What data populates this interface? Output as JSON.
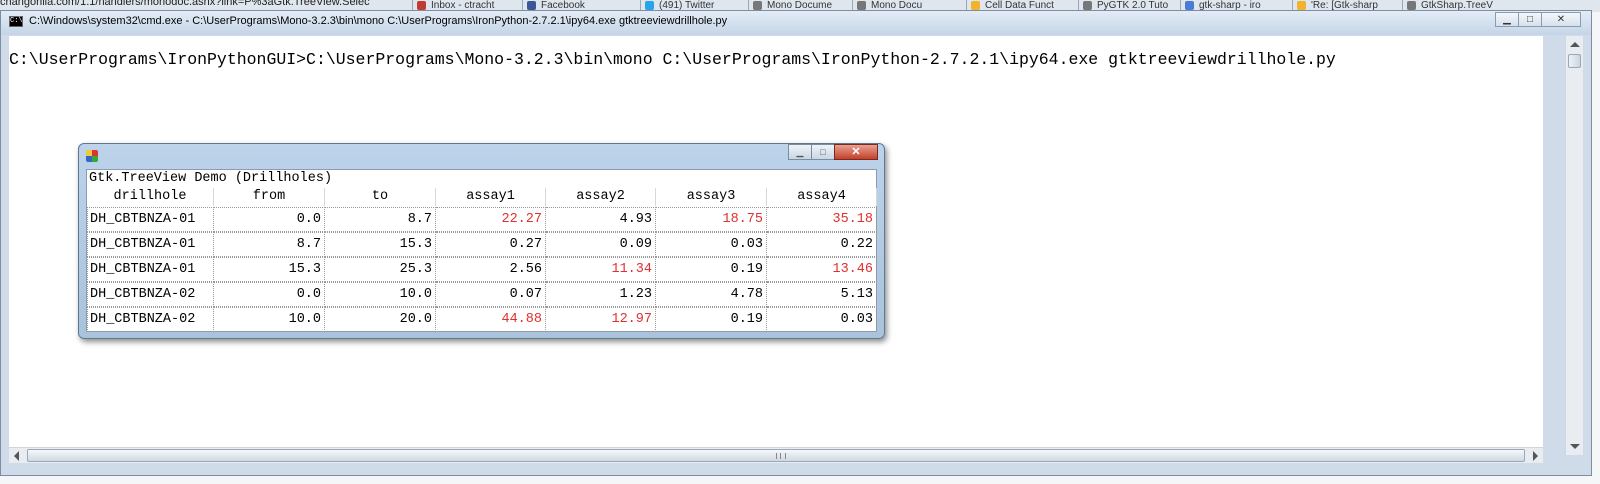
{
  "background": {
    "url": "changorilla.com/1.1/handlers/monodoc.ashx?link=P%3aGtk.TreeView.Selec",
    "tabs": [
      {
        "label": "Inbox - ctracht",
        "icon": "mail-icon",
        "color": "#c23b2e"
      },
      {
        "label": "Facebook",
        "icon": "facebook-icon",
        "color": "#3b5998"
      },
      {
        "label": "(491) Twitter",
        "icon": "twitter-icon",
        "color": "#2aa3ef"
      },
      {
        "label": "Mono Docume",
        "icon": "page-icon",
        "color": "#777777"
      },
      {
        "label": "Mono Docu",
        "icon": "page-icon",
        "color": "#777777"
      },
      {
        "label": "Cell Data Funct",
        "icon": "ie-icon",
        "color": "#f1b32a"
      },
      {
        "label": "PyGTK 2.0 Tuto",
        "icon": "page-icon",
        "color": "#777777"
      },
      {
        "label": "gtk-sharp - iro",
        "icon": "google-icon",
        "color": "#4a7cd6"
      },
      {
        "label": "'Re: [Gtk-sharp",
        "icon": "ie-icon",
        "color": "#f1b32a"
      },
      {
        "label": "GtkSharp.TreeV",
        "icon": "page-icon",
        "color": "#777777"
      }
    ]
  },
  "console": {
    "title": "C:\\Windows\\system32\\cmd.exe - C:\\UserPrograms\\Mono-3.2.3\\bin\\mono  C:\\UserPrograms\\IronPython-2.7.2.1\\ipy64.exe gtktreeviewdrillhole.py",
    "icon_text": "C:\\",
    "command_line": "C:\\UserPrograms\\IronPythonGUI>C:\\UserPrograms\\Mono-3.2.3\\bin\\mono C:\\UserPrograms\\IronPython-2.7.2.1\\ipy64.exe gtktreeviewdrillhole.py",
    "buttons": {
      "minimize": "▁",
      "maximize": "□",
      "close": "✕"
    }
  },
  "dialog": {
    "caption": "Gtk.TreeView Demo (Drillholes)",
    "buttons": {
      "minimize": "▁",
      "maximize": "□",
      "close": "✕"
    },
    "columns": [
      "drillhole",
      "from",
      "to",
      "assay1",
      "assay2",
      "assay3",
      "assay4"
    ],
    "rows": [
      {
        "cells": [
          "DH_CBTBNZA-01",
          "0.0",
          "8.7",
          "22.27",
          "4.93",
          "18.75",
          "35.18"
        ],
        "red": [
          false,
          false,
          false,
          true,
          false,
          true,
          true
        ]
      },
      {
        "cells": [
          "DH_CBTBNZA-01",
          "8.7",
          "15.3",
          "0.27",
          "0.09",
          "0.03",
          "0.22"
        ],
        "red": [
          false,
          false,
          false,
          false,
          false,
          false,
          false
        ]
      },
      {
        "cells": [
          "DH_CBTBNZA-01",
          "15.3",
          "25.3",
          "2.56",
          "11.34",
          "0.19",
          "13.46"
        ],
        "red": [
          false,
          false,
          false,
          false,
          true,
          false,
          true
        ]
      },
      {
        "cells": [
          "DH_CBTBNZA-02",
          "0.0",
          "10.0",
          "0.07",
          "1.23",
          "4.78",
          "5.13"
        ],
        "red": [
          false,
          false,
          false,
          false,
          false,
          false,
          false
        ]
      },
      {
        "cells": [
          "DH_CBTBNZA-02",
          "10.0",
          "20.0",
          "44.88",
          "12.97",
          "0.19",
          "0.03"
        ],
        "red": [
          false,
          false,
          false,
          true,
          true,
          false,
          false
        ]
      }
    ],
    "highlight_color": "#e03030"
  }
}
